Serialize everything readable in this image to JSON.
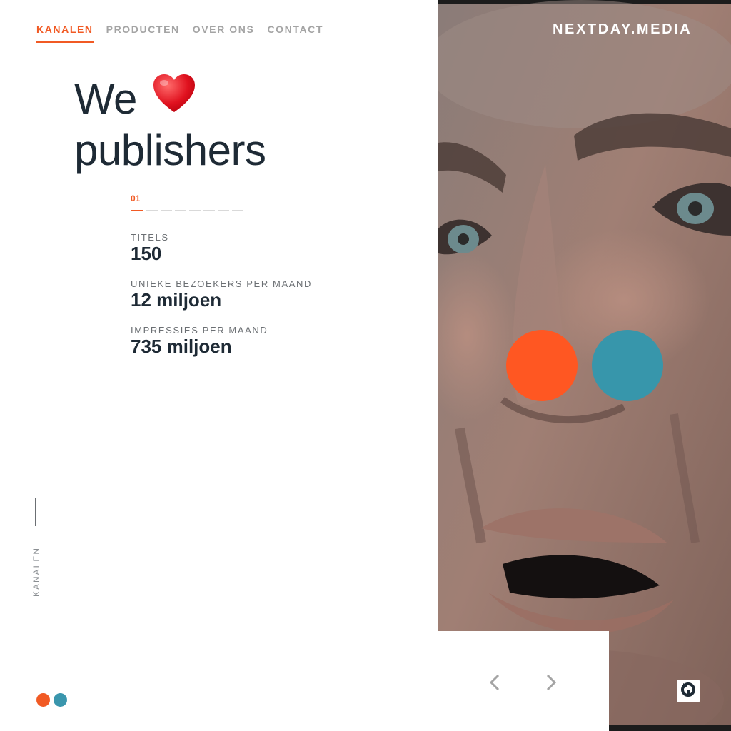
{
  "nav": {
    "items": [
      {
        "label": "KANALEN",
        "active": true
      },
      {
        "label": "PRODUCTEN",
        "active": false
      },
      {
        "label": "OVER ONS",
        "active": false
      },
      {
        "label": "CONTACT",
        "active": false
      }
    ]
  },
  "brand": "NEXTDAY.MEDIA",
  "headline": {
    "line1": "We",
    "heart_icon": "heart-emoji",
    "line2": "publishers"
  },
  "slider": {
    "current": "01",
    "total_slides": 8,
    "active_index": 0
  },
  "stats": [
    {
      "label": "TITELS",
      "value": "150"
    },
    {
      "label": "UNIEKE BEZOEKERS PER MAAND",
      "value": "12 miljoen"
    },
    {
      "label": "IMPRESSIES PER MAAND",
      "value": "735 miljoen"
    }
  ],
  "side_label": "KANALEN",
  "colors": {
    "accent": "#f15a24",
    "secondary": "#3a96ad",
    "text": "#1e2a35",
    "muted": "#a4a4a4"
  },
  "icons": {
    "prev": "chevron-left-icon",
    "next": "chevron-right-icon",
    "badge": "refresh-icon"
  }
}
